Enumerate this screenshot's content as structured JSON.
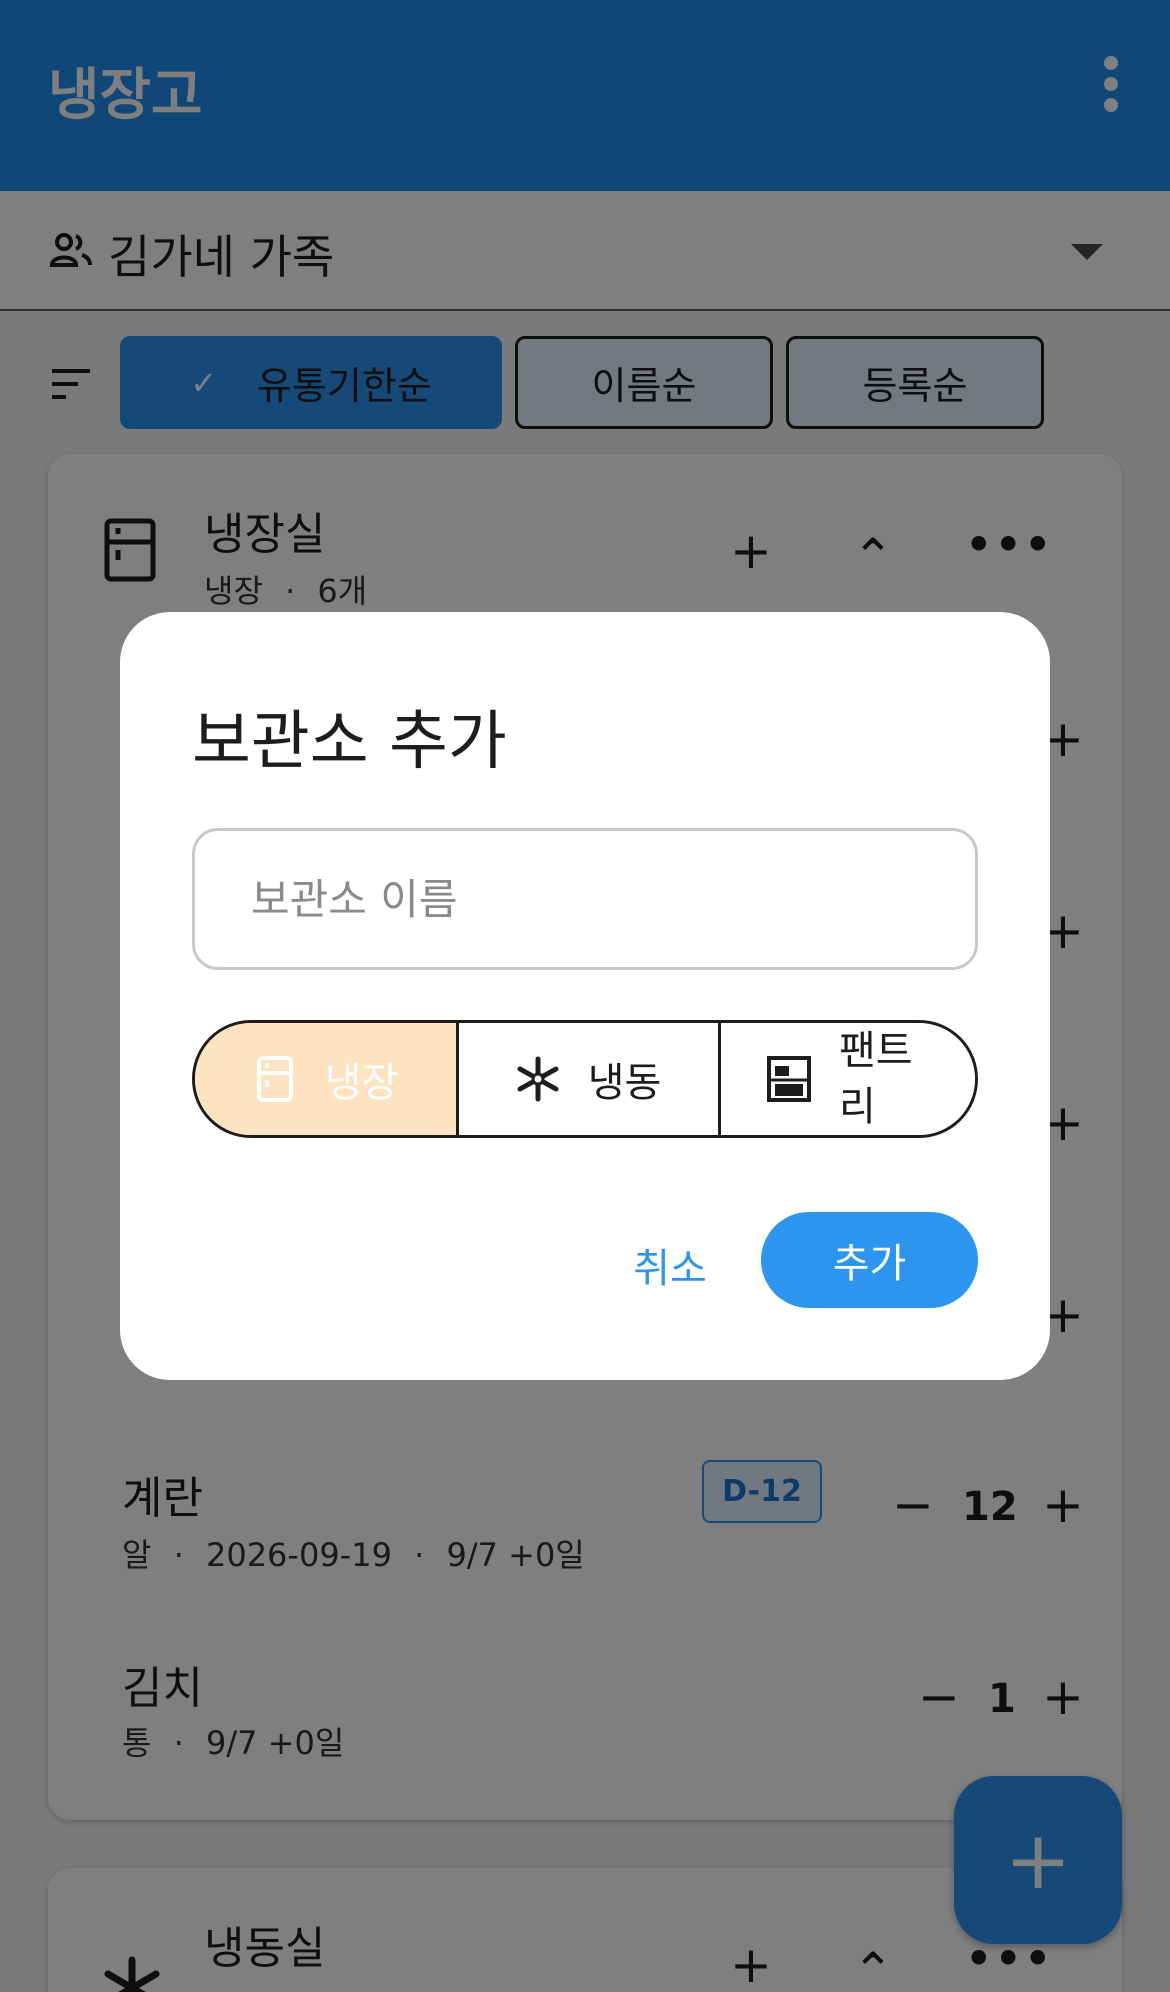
{
  "app_bar": {
    "title": "냉장고",
    "menu_icon": "more-vert-icon"
  },
  "family": {
    "name": "김가네 가족",
    "icon": "people-icon",
    "dropdown_icon": "arrow-drop-down-icon"
  },
  "sort": {
    "icon": "sort-icon",
    "options": [
      {
        "label": "유통기한순",
        "selected": true,
        "check_icon": "✓"
      },
      {
        "label": "이름순",
        "selected": false
      },
      {
        "label": "등록순",
        "selected": false
      }
    ]
  },
  "storages": [
    {
      "name": "냉장실",
      "type_label": "냉장",
      "count": "6개",
      "separator": "·",
      "icon": "fridge-icon",
      "actions": {
        "add": "+",
        "collapse": "⌃",
        "more": "•••"
      }
    },
    {
      "name": "냉동실",
      "icon": "snowflake-icon",
      "actions": {
        "add": "+",
        "collapse": "⌃",
        "more": "•••"
      }
    }
  ],
  "items": [
    {
      "name": "계란",
      "unit": "알",
      "expiry": "2026-09-19",
      "added": "9/7 +0일",
      "badge": "D-12",
      "quantity": "12",
      "minus": "−",
      "plus": "+",
      "separator": "·"
    },
    {
      "name": "김치",
      "unit": "통",
      "added": "9/7 +0일",
      "quantity": "1",
      "minus": "−",
      "plus": "+",
      "separator": "·"
    }
  ],
  "hidden_row_plus": "+",
  "fab": {
    "label": "+",
    "icon": "add-icon"
  },
  "dialog": {
    "title": "보관소 추가",
    "name_field": {
      "placeholder": "보관소 이름",
      "value": ""
    },
    "types": [
      {
        "label": "냉장",
        "icon": "fridge-icon",
        "selected": true
      },
      {
        "label": "냉동",
        "icon": "snowflake-icon",
        "selected": false
      },
      {
        "label": "팬트리",
        "icon": "pantry-icon",
        "selected": false
      }
    ],
    "cancel_label": "취소",
    "confirm_label": "추가"
  },
  "colors": {
    "primary": "#1f8ff0",
    "selected_segment": "#fde3bf",
    "badge_text": "#1776d6"
  }
}
